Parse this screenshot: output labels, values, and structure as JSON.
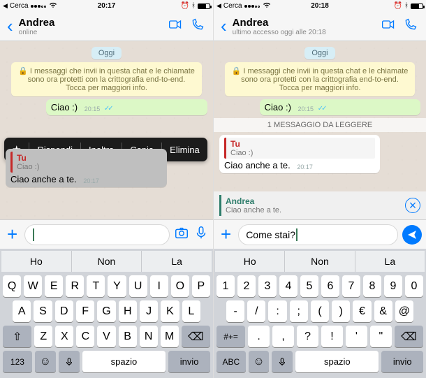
{
  "left": {
    "status": {
      "carrier_prefix": "◀",
      "carrier": "Cerca",
      "signal": "●●●○○",
      "time": "20:17",
      "bt": "✱",
      "wifi": "✱",
      "batt_pct": 70
    },
    "header": {
      "name": "Andrea",
      "sub": "online"
    },
    "date": "Oggi",
    "encryption": "I messaggi che invii in questa chat e le chiamate sono ora protetti con la crittografia end-to-end. Tocca per maggiori info.",
    "msg_out": {
      "text": "Ciao :)",
      "time": "20:15"
    },
    "ctx": {
      "star": "★",
      "a": "Rispondi",
      "b": "Inoltra",
      "c": "Copia",
      "d": "Elimina"
    },
    "msg_in": {
      "reply_who": "Tu",
      "reply_what": "Ciao :)",
      "text": "Ciao anche a te.",
      "time": "20:17"
    },
    "input": {
      "value": ""
    },
    "pred": {
      "a": "Ho",
      "b": "Non",
      "c": "La"
    },
    "kb": {
      "r1": [
        "Q",
        "W",
        "E",
        "R",
        "T",
        "Y",
        "U",
        "I",
        "O",
        "P"
      ],
      "r2": [
        "A",
        "S",
        "D",
        "F",
        "G",
        "H",
        "J",
        "K",
        "L"
      ],
      "r3": [
        "Z",
        "X",
        "C",
        "V",
        "B",
        "N",
        "M"
      ],
      "num": "123",
      "space": "spazio",
      "ret": "invio"
    }
  },
  "right": {
    "status": {
      "carrier_prefix": "◀",
      "carrier": "Cerca",
      "signal": "●●●○○",
      "time": "20:18",
      "batt_pct": 70
    },
    "header": {
      "name": "Andrea",
      "sub": "ultimo accesso oggi alle 20:18"
    },
    "date": "Oggi",
    "encryption": "I messaggi che invii in questa chat e le chiamate sono ora protetti con la crittografia end-to-end. Tocca per maggiori info.",
    "msg_out": {
      "text": "Ciao :)",
      "time": "20:15"
    },
    "unread": "1 MESSAGGIO DA LEGGERE",
    "msg_in": {
      "reply_who": "Tu",
      "reply_what": "Ciao :)",
      "text": "Ciao anche a te.",
      "time": "20:17"
    },
    "reply_preview": {
      "who": "Andrea",
      "what": "Ciao anche a te."
    },
    "input": {
      "value": "Come stai?"
    },
    "pred": {
      "a": "Ho",
      "b": "Non",
      "c": "La"
    },
    "kb": {
      "r1": [
        "1",
        "2",
        "3",
        "4",
        "5",
        "6",
        "7",
        "8",
        "9",
        "0"
      ],
      "r2": [
        "-",
        "/",
        ":",
        ";",
        "(",
        ")",
        "€",
        "&",
        "@"
      ],
      "r3": [
        ".",
        ",",
        "?",
        "!",
        "'",
        "\""
      ],
      "sym": "#+=",
      "abc": "ABC",
      "space": "spazio",
      "ret": "invio"
    }
  }
}
